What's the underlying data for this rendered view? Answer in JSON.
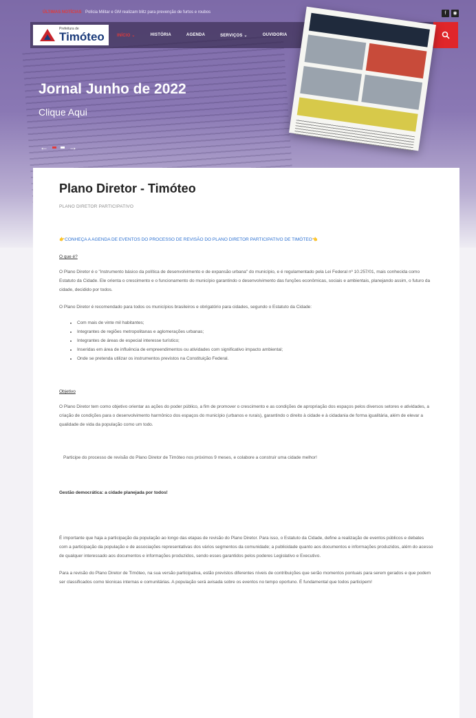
{
  "topbar": {
    "alert_label": "ÚLTIMAS NOTÍCIAS",
    "alert_text": "Polícia Militar e GM realizam blitz para prevenção de furtos e roubos",
    "btn1": "f",
    "btn2": "◉"
  },
  "brand": {
    "small": "Prefeitura de",
    "name": "Timóteo"
  },
  "nav": {
    "items": [
      "INÍCIO ⌄",
      "HISTÓRIA",
      "AGENDA",
      "SERVIÇOS ⌄",
      "OUVIDORIA"
    ]
  },
  "hero": {
    "title": "Jornal Junho de 2022",
    "cta": "Clique Aqui",
    "prev": "←",
    "next": "→"
  },
  "page": {
    "title": "Plano Diretor - Timóteo",
    "subtitle": "PLANO DIRETOR PARTICIPATIVO",
    "link": "👉CONHEÇA A AGENDA DE EVENTOS DO PROCESSO DE REVISÃO DO PLANO DIRETOR PARTICIPATIVO DE TIMÓTEO👈",
    "section1_head": "O que é?",
    "section1_p1": "O Plano Diretor é o \"instrumento básico da política de desenvolvimento e de expansão urbana\" do município, e é regulamentado pela Lei Federal nº 10.257/01, mais conhecida como Estatuto da Cidade. Ele orienta o crescimento e o funcionamento do município garantindo o desenvolvimento das funções econômicas, sociais e ambientais, planejando assim, o futuro da cidade, decidido por todos.",
    "section1_p2": "O Plano Diretor é recomendado para todos os municípios brasileiros e obrigatório para cidades, segundo o Estatuto da Cidade:",
    "bullets": [
      "Com mais de vinte mil habitantes;",
      "Integrantes de regiões metropolitanas e aglomerações urbanas;",
      "Integrantes de áreas de especial interesse turístico;",
      "Inseridas em área de influência de empreendimentos ou atividades com significativo impacto ambiental;",
      "Onde se pretenda utilizar os instrumentos previstos na Constituição Federal."
    ],
    "section2_head": "Objetivo",
    "section2_p": "O Plano Diretor tem como objetivo orientar as ações do poder público, a fim de promover o crescimento e as condições de apropriação dos espaços pelos diversos setores e atividades, a criação de condições para o desenvolvimento harmônico dos espaços do município (urbanos e rurais), garantindo o direito à cidade e à cidadania de forma igualitária, além de elevar a qualidade de vida da população como um todo.",
    "quote": "Participe do processo de revisão do Plano Diretor de Timóteo nos próximos 9 meses, e colabore a construir uma cidade melhor!",
    "bold_head": "Gestão democrática: a cidade planejada por todos!",
    "p3": "É importante que haja a participação da população ao longo das etapas de revisão do Plano Diretor. Para isso, o Estatuto da Cidade, define a realização de eventos públicos e debates com a participação da população e de associações representativas dos vários segmentos da comunidade; a publicidade quanto aos documentos e informações produzidos, além do acesso de qualquer interessado aos documentos e informações produzidos, sendo esses garantidos pelos poderes Legislativo e Executivo.",
    "p4": "Para a revisão do Plano Diretor de Timóteo, na sua versão participativa, estão previstos diferentes níveis de contribuições que serão momentos pontuais para serem gerados e que podem ser classificados como técnicas internas e comunitárias. A população será avisada sobre os eventos no tempo oportuno. É fundamental que todos participem!"
  },
  "colors": {
    "accent": "#e0262a",
    "link": "#2a6fd0",
    "hero_purple": "#7d6aa8"
  }
}
